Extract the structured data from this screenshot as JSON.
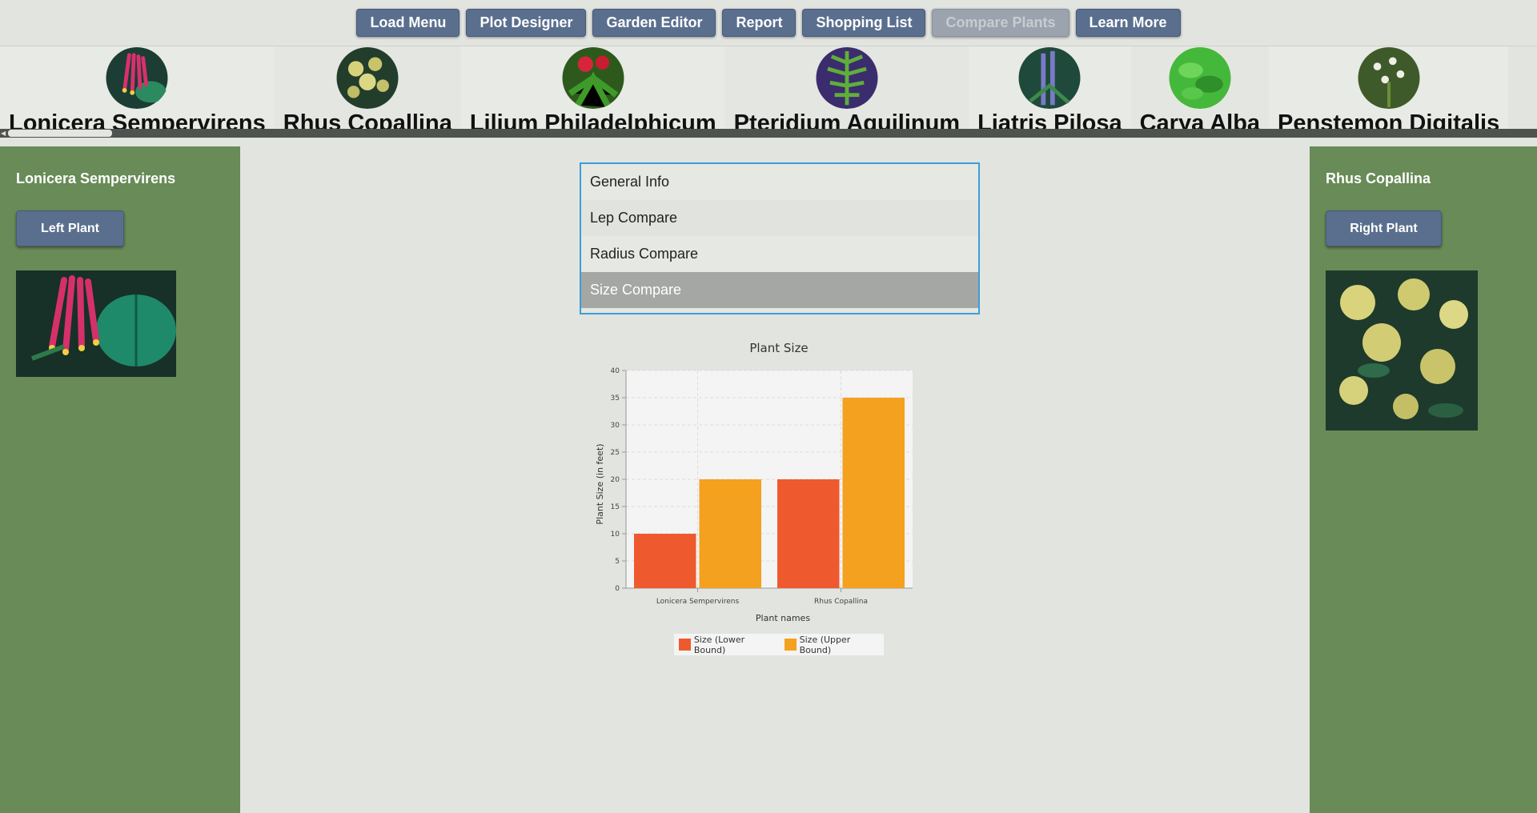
{
  "nav": {
    "buttons": [
      "Load Menu",
      "Plot Designer",
      "Garden Editor",
      "Report",
      "Shopping List",
      "Compare Plants",
      "Learn More"
    ]
  },
  "plants": [
    "Lonicera Sempervirens",
    "Rhus Copallina",
    "Lilium Philadelphicum",
    "Pteridium Aquilinum",
    "Liatris Pilosa",
    "Carya Alba",
    "Penstemon Digitalis"
  ],
  "left_panel": {
    "title": "Lonicera Sempervirens",
    "button": "Left Plant"
  },
  "right_panel": {
    "title": "Rhus Copallina",
    "button": "Right Plant"
  },
  "compare_options": [
    "General Info",
    "Lep Compare",
    "Radius Compare",
    "Size Compare"
  ],
  "selected_option": "Size Compare",
  "colors": {
    "accent": "#5a6f8e",
    "side_bg": "#688b57",
    "selection_border": "#3a9fd8",
    "lower": "#ee5a2e",
    "upper": "#f4a11f"
  },
  "chart_data": {
    "type": "bar",
    "title": "Plant Size",
    "xlabel": "Plant names",
    "ylabel": "Plant Size (in feet)",
    "categories": [
      "Lonicera Sempervirens",
      "Rhus Copallina"
    ],
    "series": [
      {
        "name": "Size (Lower Bound)",
        "values": [
          10,
          20
        ],
        "color": "#ee5a2e"
      },
      {
        "name": "Size (Upper Bound)",
        "values": [
          20,
          35
        ],
        "color": "#f4a11f"
      }
    ],
    "ylim": [
      0,
      40
    ],
    "yticks": [
      0,
      5,
      10,
      15,
      20,
      25,
      30,
      35,
      40
    ],
    "grid": true,
    "legend": "bottom"
  }
}
